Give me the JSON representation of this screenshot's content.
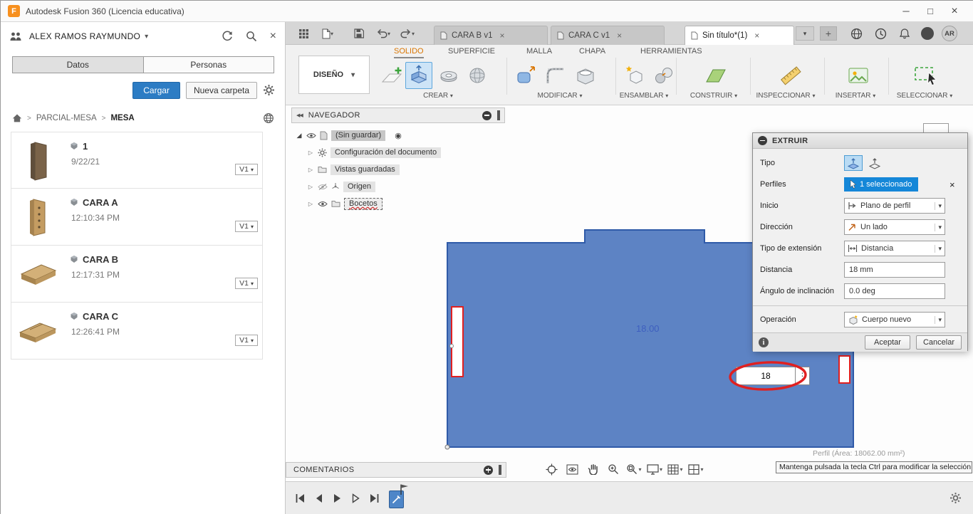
{
  "window": {
    "title": "Autodesk Fusion 360 (Licencia educativa)"
  },
  "icons": {
    "logo_letter": "F",
    "chevron_down": "▾",
    "close": "×",
    "plus": "+",
    "kebab": "⋮",
    "info": "i",
    "breadcrumb_sep": ">",
    "tree_collapsed": "▷",
    "tree_expanded": "◢",
    "radio": "◉",
    "collapse_double": "◀◀",
    "win_min": "─",
    "win_max": "□",
    "win_close": "×"
  },
  "data_panel": {
    "user": "ALEX RAMOS RAYMUNDO",
    "tab_datos": "Datos",
    "tab_personas": "Personas",
    "upload_button": "Cargar",
    "new_folder_button": "Nueva carpeta",
    "breadcrumb": {
      "root": "PARCIAL-MESA",
      "current": "MESA"
    },
    "items": [
      {
        "name": "1",
        "time": "9/22/21",
        "version": "V1"
      },
      {
        "name": "CARA A",
        "time": "12:10:34 PM",
        "version": "V1"
      },
      {
        "name": "CARA B",
        "time": "12:17:31 PM",
        "version": "V1"
      },
      {
        "name": "CARA C",
        "time": "12:26:41 PM",
        "version": "V1"
      }
    ]
  },
  "doc_bar": {
    "tabs": [
      {
        "label": "CARA B v1"
      },
      {
        "label": "CARA C v1"
      },
      {
        "label": "Sin título*(1)"
      }
    ],
    "avatar": "AR"
  },
  "ribbon": {
    "workspace_selector": "DISEÑO",
    "tabs": [
      "SOLIDO",
      "SUPERFICIE",
      "MALLA",
      "CHAPA",
      "HERRAMIENTAS"
    ],
    "groups": [
      "CREAR",
      "MODIFICAR",
      "ENSAMBLAR",
      "CONSTRUIR",
      "INSPECCIONAR",
      "INSERTAR",
      "SELECCIONAR"
    ]
  },
  "navegador": {
    "title": "NAVEGADOR",
    "root_label": "(Sin guardar)",
    "items": [
      "Configuración del documento",
      "Vistas guardadas",
      "Origen",
      "Bocetos"
    ]
  },
  "canvas": {
    "dimension_text": "18.00",
    "dimension_input": "18",
    "hover_info": "Perfil (Área: 18062.00 mm²)",
    "tooltip": "Mantenga pulsada la tecla Ctrl para modificar la selección"
  },
  "extrude_dialog": {
    "title": "EXTRUIR",
    "type_label": "Tipo",
    "profiles_label": "Perfiles",
    "profiles_value": "1 seleccionado",
    "start_label": "Inicio",
    "start_value": "Plano de perfil",
    "direction_label": "Dirección",
    "direction_value": "Un lado",
    "extent_label": "Tipo de extensión",
    "extent_value": "Distancia",
    "distance_label": "Distancia",
    "distance_value": "18 mm",
    "taper_label": "Ángulo de inclinación",
    "taper_value": "0.0 deg",
    "operation_label": "Operación",
    "operation_value": "Cuerpo nuevo",
    "ok": "Aceptar",
    "cancel": "Cancelar"
  },
  "comments": {
    "title": "COMENTARIOS"
  },
  "colors": {
    "accent_blue": "#0696D7",
    "selection_fill": "#5D83C4",
    "selection_edge": "#2F5AA8",
    "annotation_red": "#E02020",
    "active_tab_orange": "#D97500"
  }
}
